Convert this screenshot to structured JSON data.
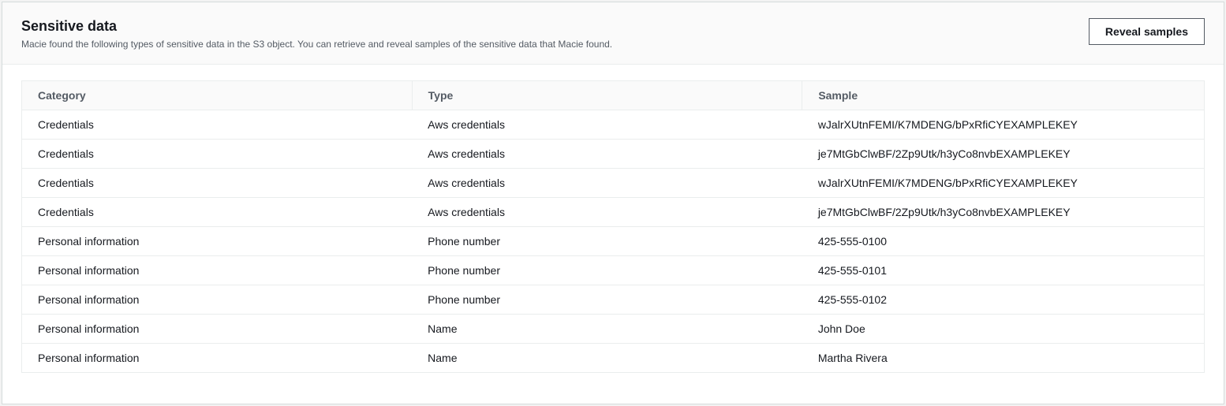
{
  "header": {
    "title": "Sensitive data",
    "description": "Macie found the following types of sensitive data in the S3 object. You can retrieve and reveal samples of the sensitive data that Macie found.",
    "reveal_button": "Reveal samples"
  },
  "table": {
    "columns": {
      "category": "Category",
      "type": "Type",
      "sample": "Sample"
    },
    "rows": [
      {
        "category": "Credentials",
        "type": "Aws credentials",
        "sample": "wJalrXUtnFEMI/K7MDENG/bPxRfiCYEXAMPLEKEY"
      },
      {
        "category": "Credentials",
        "type": "Aws credentials",
        "sample": "je7MtGbClwBF/2Zp9Utk/h3yCo8nvbEXAMPLEKEY"
      },
      {
        "category": "Credentials",
        "type": "Aws credentials",
        "sample": "wJalrXUtnFEMI/K7MDENG/bPxRfiCYEXAMPLEKEY"
      },
      {
        "category": "Credentials",
        "type": "Aws credentials",
        "sample": "je7MtGbClwBF/2Zp9Utk/h3yCo8nvbEXAMPLEKEY"
      },
      {
        "category": "Personal information",
        "type": "Phone number",
        "sample": "425-555-0100"
      },
      {
        "category": "Personal information",
        "type": "Phone number",
        "sample": "425-555-0101"
      },
      {
        "category": "Personal information",
        "type": "Phone number",
        "sample": "425-555-0102"
      },
      {
        "category": "Personal information",
        "type": "Name",
        "sample": "John Doe"
      },
      {
        "category": "Personal information",
        "type": "Name",
        "sample": "Martha Rivera"
      }
    ]
  }
}
